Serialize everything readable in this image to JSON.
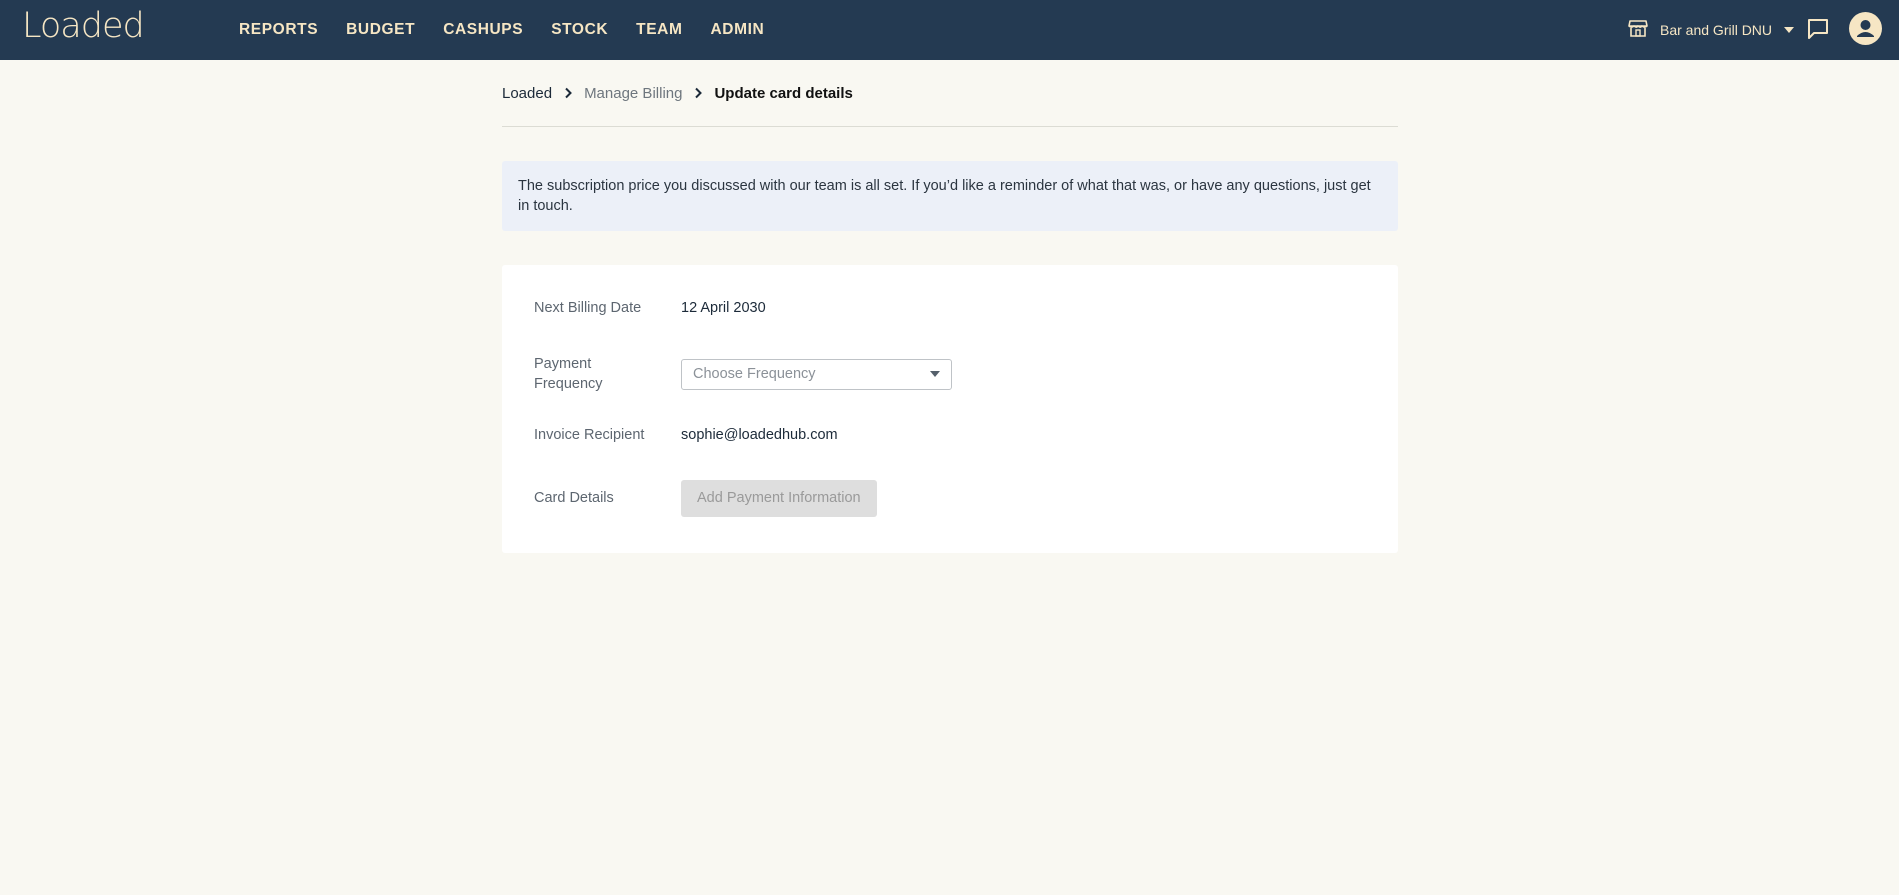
{
  "brand": {
    "logo_text": "Loaded"
  },
  "nav": {
    "items": [
      {
        "label": "REPORTS"
      },
      {
        "label": "BUDGET"
      },
      {
        "label": "CASHUPS"
      },
      {
        "label": "STOCK"
      },
      {
        "label": "TEAM"
      },
      {
        "label": "ADMIN"
      }
    ]
  },
  "header_tools": {
    "store_icon": "store-icon",
    "store_name": "Bar and Grill DNU",
    "chat_icon": "chat-icon",
    "avatar_icon": "user-avatar-icon"
  },
  "breadcrumb": {
    "items": [
      {
        "label": "Loaded"
      },
      {
        "label": "Manage Billing"
      },
      {
        "label": "Update card details"
      }
    ]
  },
  "info_banner": {
    "text": "The subscription price you discussed with our team is all set. If you’d like a reminder of what that was, or have any questions, just get in touch."
  },
  "billing": {
    "next_billing_date_label": "Next Billing Date",
    "next_billing_date_value": "12 April 2030",
    "payment_frequency_label": "Payment Frequency",
    "payment_frequency_placeholder": "Choose Frequency",
    "invoice_recipient_label": "Invoice Recipient",
    "invoice_recipient_value": "sophie@loadedhub.com",
    "card_details_label": "Card Details",
    "add_payment_button": "Add Payment Information"
  },
  "colors": {
    "topbar_bg": "#243a52",
    "topbar_text": "#f6e6c4",
    "page_bg": "#f9f8f2",
    "banner_bg": "#ecf0f8",
    "disabled_button_bg": "#dedede"
  }
}
